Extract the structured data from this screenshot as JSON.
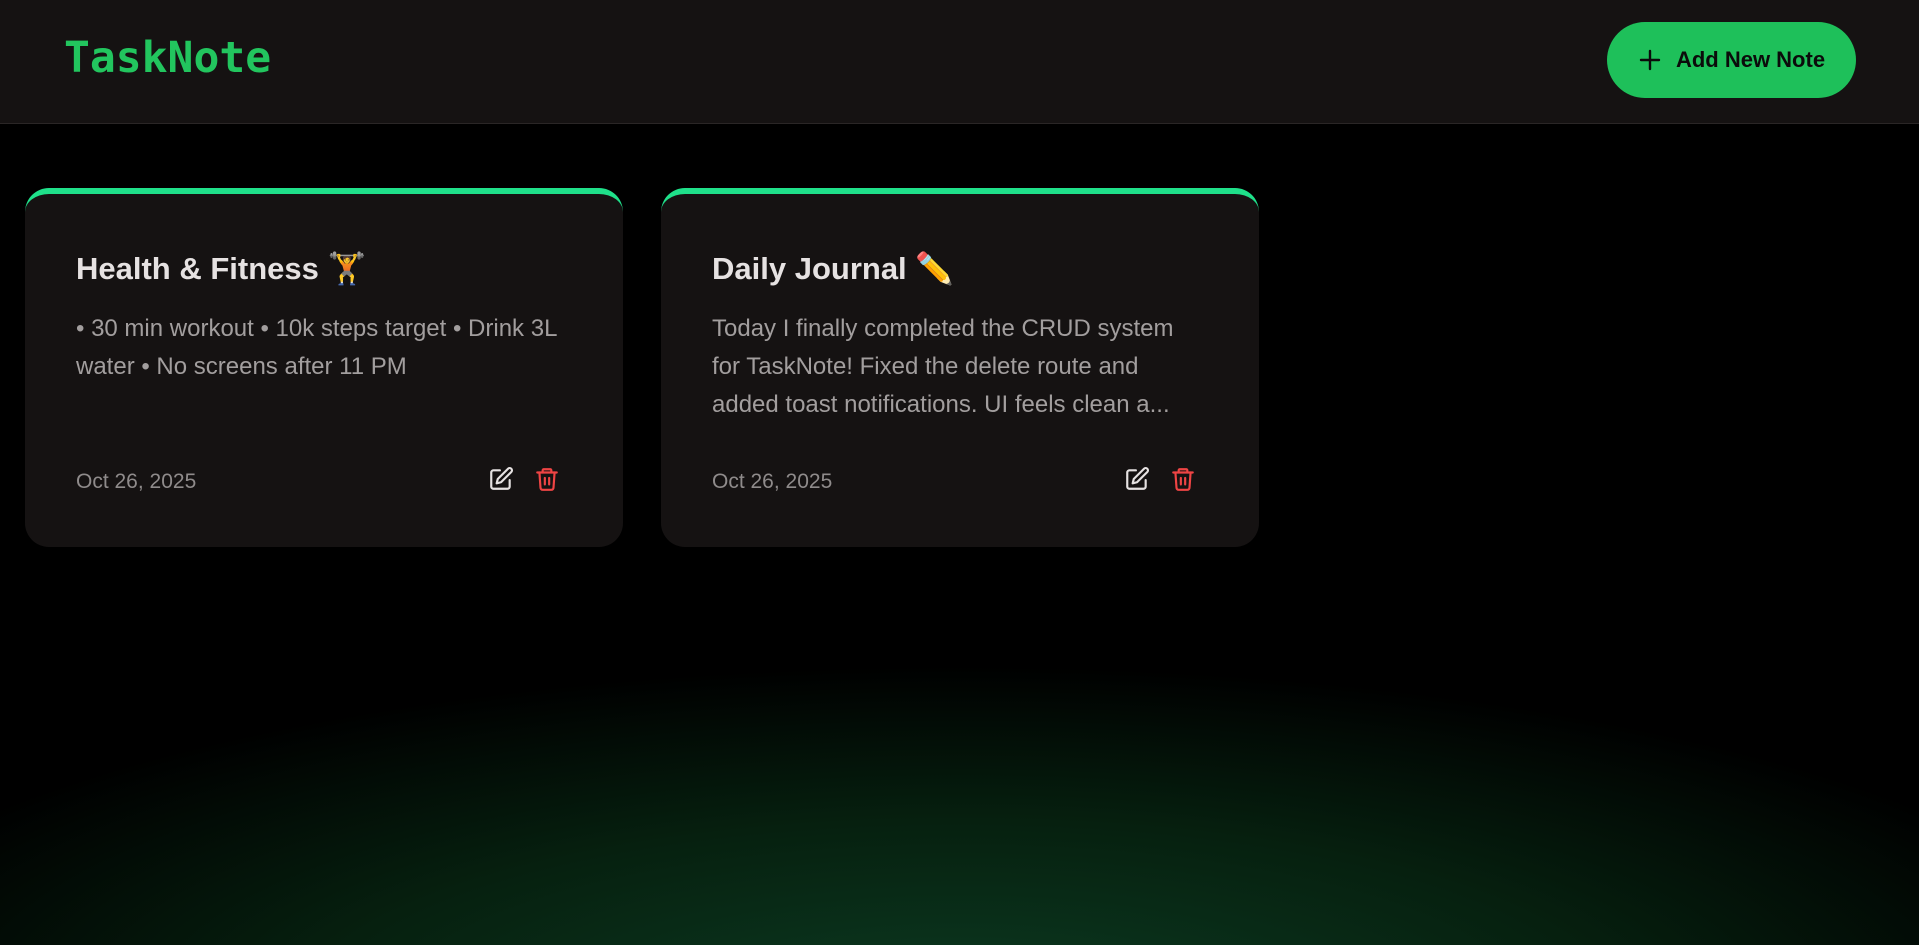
{
  "app": {
    "title": "TaskNote"
  },
  "header": {
    "logo": "TaskNote",
    "add_button_label": "Add New Note",
    "add_button_icon": "plus-icon"
  },
  "notes": [
    {
      "title": "Health & Fitness 🏋️",
      "body": "• 30 min workout • 10k steps target • Drink 3L water • No screens after 11 PM",
      "date": "Oct 26, 2025",
      "edit_icon": "edit-icon",
      "delete_icon": "trash-icon"
    },
    {
      "title": "Daily Journal ✏️",
      "body": "Today I finally completed the CRUD system for TaskNote! Fixed the delete route and added toast notifications. UI feels clean a...",
      "date": "Oct 26, 2025",
      "edit_icon": "edit-icon",
      "delete_icon": "trash-icon"
    }
  ],
  "colors": {
    "accent": "#22c55e",
    "card_top_border": "#1fe08a",
    "delete": "#ef4444",
    "card_bg": "#151212",
    "navbar_bg": "#151212"
  }
}
